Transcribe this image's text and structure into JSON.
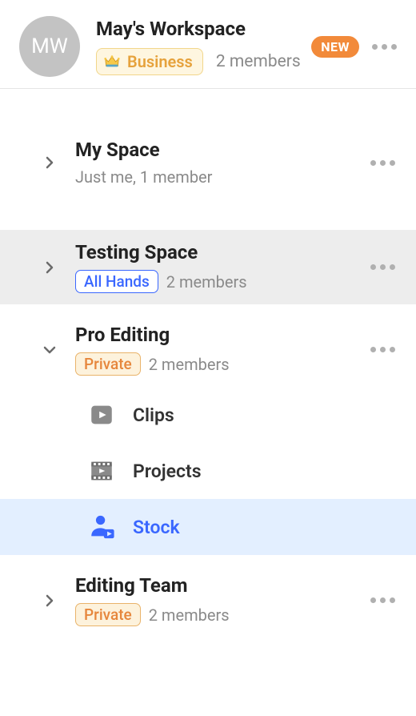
{
  "header": {
    "avatar_initials": "MW",
    "title": "May's Workspace",
    "plan_label": "Business",
    "members": "2 members",
    "new_label": "NEW"
  },
  "spaces": [
    {
      "title": "My Space",
      "subtitle": "Just me, 1 member",
      "expanded": false,
      "selected": false,
      "tag": null,
      "members": null
    },
    {
      "title": "Testing Space",
      "subtitle": null,
      "expanded": false,
      "selected": true,
      "tag": {
        "text": "All Hands",
        "style": "allhands"
      },
      "members": "2 members"
    },
    {
      "title": "Pro Editing",
      "subtitle": null,
      "expanded": true,
      "selected": false,
      "tag": {
        "text": "Private",
        "style": "private"
      },
      "members": "2 members",
      "children": [
        {
          "label": "Clips",
          "icon": "play-square",
          "active": false
        },
        {
          "label": "Projects",
          "icon": "film",
          "active": false
        },
        {
          "label": "Stock",
          "icon": "person-play",
          "active": true
        }
      ]
    },
    {
      "title": "Editing Team",
      "subtitle": null,
      "expanded": false,
      "selected": false,
      "tag": {
        "text": "Private",
        "style": "private"
      },
      "members": "2 members"
    }
  ]
}
